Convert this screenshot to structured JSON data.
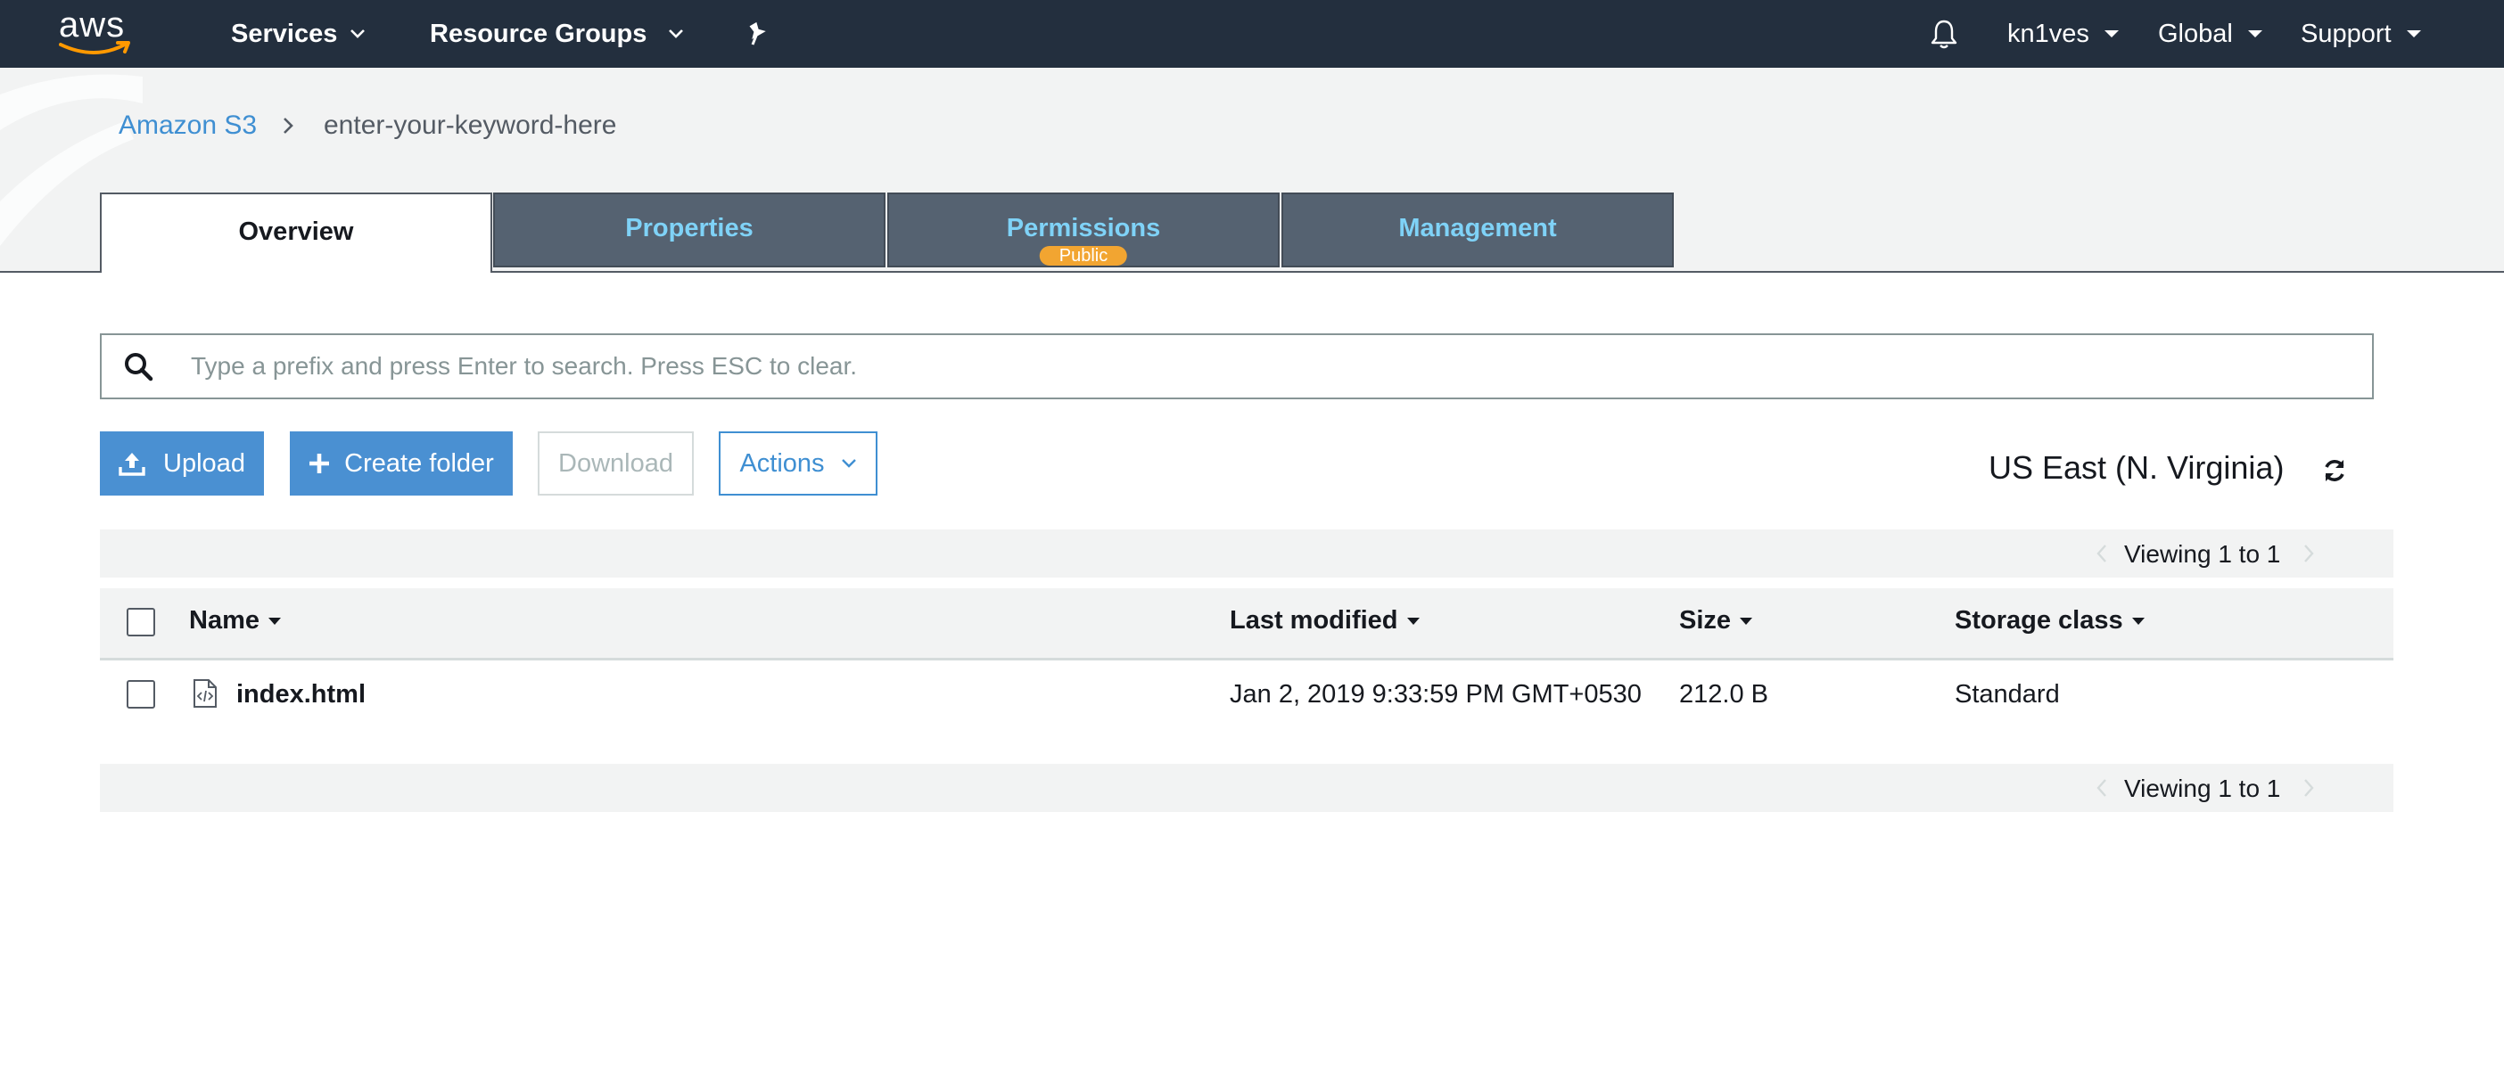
{
  "topnav": {
    "logo_text": "aws",
    "services": "Services",
    "resource_groups": "Resource Groups",
    "user": "kn1ves",
    "region_menu": "Global",
    "support": "Support"
  },
  "breadcrumb": {
    "root": "Amazon S3",
    "current": "enter-your-keyword-here"
  },
  "tabs": [
    {
      "label": "Overview",
      "active": true
    },
    {
      "label": "Properties"
    },
    {
      "label": "Permissions",
      "badge": "Public"
    },
    {
      "label": "Management"
    }
  ],
  "search": {
    "value": "",
    "placeholder": "Type a prefix and press Enter to search. Press ESC to clear."
  },
  "toolbar": {
    "upload": "Upload",
    "create_folder": "Create folder",
    "download": "Download",
    "actions": "Actions"
  },
  "region": "US East (N. Virginia)",
  "pager": {
    "top": "Viewing 1 to 1",
    "bottom": "Viewing 1 to 1"
  },
  "table": {
    "columns": [
      "Name",
      "Last modified",
      "Size",
      "Storage class"
    ],
    "rows": [
      {
        "name": "index.html",
        "last_modified": "Jan 2, 2019 9:33:59 PM GMT+0530",
        "size": "212.0 B",
        "storage_class": "Standard"
      }
    ]
  },
  "colors": {
    "nav_bg": "#232f3e",
    "tab_bg": "#556271",
    "tab_text": "#7fd2f7",
    "primary": "#4a90d2",
    "link": "#3f8fd2",
    "badge": "#f2a531"
  },
  "icons": [
    "aws-smile-icon",
    "caret-down-icon",
    "pin-icon",
    "bell-icon",
    "chevron-right-icon",
    "search-icon",
    "upload-icon",
    "plus-icon",
    "chevron-down-icon",
    "refresh-icon",
    "sort-down-icon",
    "file-code-icon",
    "chevron-left-icon"
  ]
}
